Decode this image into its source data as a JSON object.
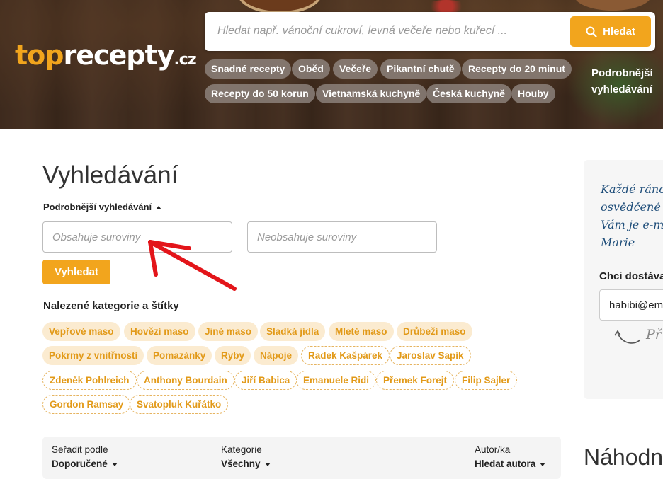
{
  "header": {
    "logo": {
      "part1": "top",
      "part2": "recepty",
      "tld": ".cz"
    },
    "search": {
      "placeholder": "Hledat např. vánoční cukroví, levná večeře nebo kuřecí ...",
      "button": "Hledat"
    },
    "quick_tags": [
      "Snadné recepty",
      "Oběd",
      "Večeře",
      "Pikantní chutě",
      "Recepty do 20 minut",
      "Recepty do 50 korun",
      "Vietnamská kuchyně",
      "Česká kuchyně",
      "Houby"
    ],
    "advanced_link": {
      "line1": "Podrobnější",
      "line2": "vyhledávání"
    }
  },
  "main": {
    "title": "Vyhledávání",
    "advanced_toggle": "Podrobnější vyhledávání",
    "contains_placeholder": "Obsahuje suroviny",
    "not_contains_placeholder": "Neobsahuje suroviny",
    "search_button": "Vyhledat",
    "found_heading": "Nalezené kategorie a štítky",
    "categories": [
      "Vepřové maso",
      "Hovězí maso",
      "Jiné maso",
      "Sladká jídla",
      "Mleté maso",
      "Drůbeží maso",
      "Pokrmy z vnitřností",
      "Pomazánky",
      "Ryby",
      "Nápoje"
    ],
    "authors": [
      "Radek Kašpárek",
      "Jaroslav Sapík",
      "Zdeněk Pohlreich",
      "Anthony Bourdain",
      "Jiří Babica",
      "Emanuele Ridi",
      "Přemek Forejt",
      "Filip Sajler",
      "Gordon Ramsay",
      "Svatopluk Kuřátko"
    ]
  },
  "sidebar": {
    "newsletter_text": [
      "Každé ráno",
      "osvědčené r",
      "Vám je e-ma",
      "Marie"
    ],
    "subscribe_label": "Chci dostáva",
    "email_value": "habibi@em",
    "handwritten_note": "Př"
  },
  "sort": {
    "sort_by_label": "Seřadit podle",
    "sort_by_value": "Doporučené",
    "category_label": "Kategorie",
    "category_value": "Všechny",
    "author_label": "Autor/ka",
    "author_value": "Hledat autora"
  },
  "random_heading": "Náhodn",
  "colors": {
    "accent": "#f2a51d",
    "chip_bg": "#fbebd0",
    "chip_text": "#e29a19",
    "annotation": "#e3151a",
    "script_blue": "#1f4e7a"
  }
}
